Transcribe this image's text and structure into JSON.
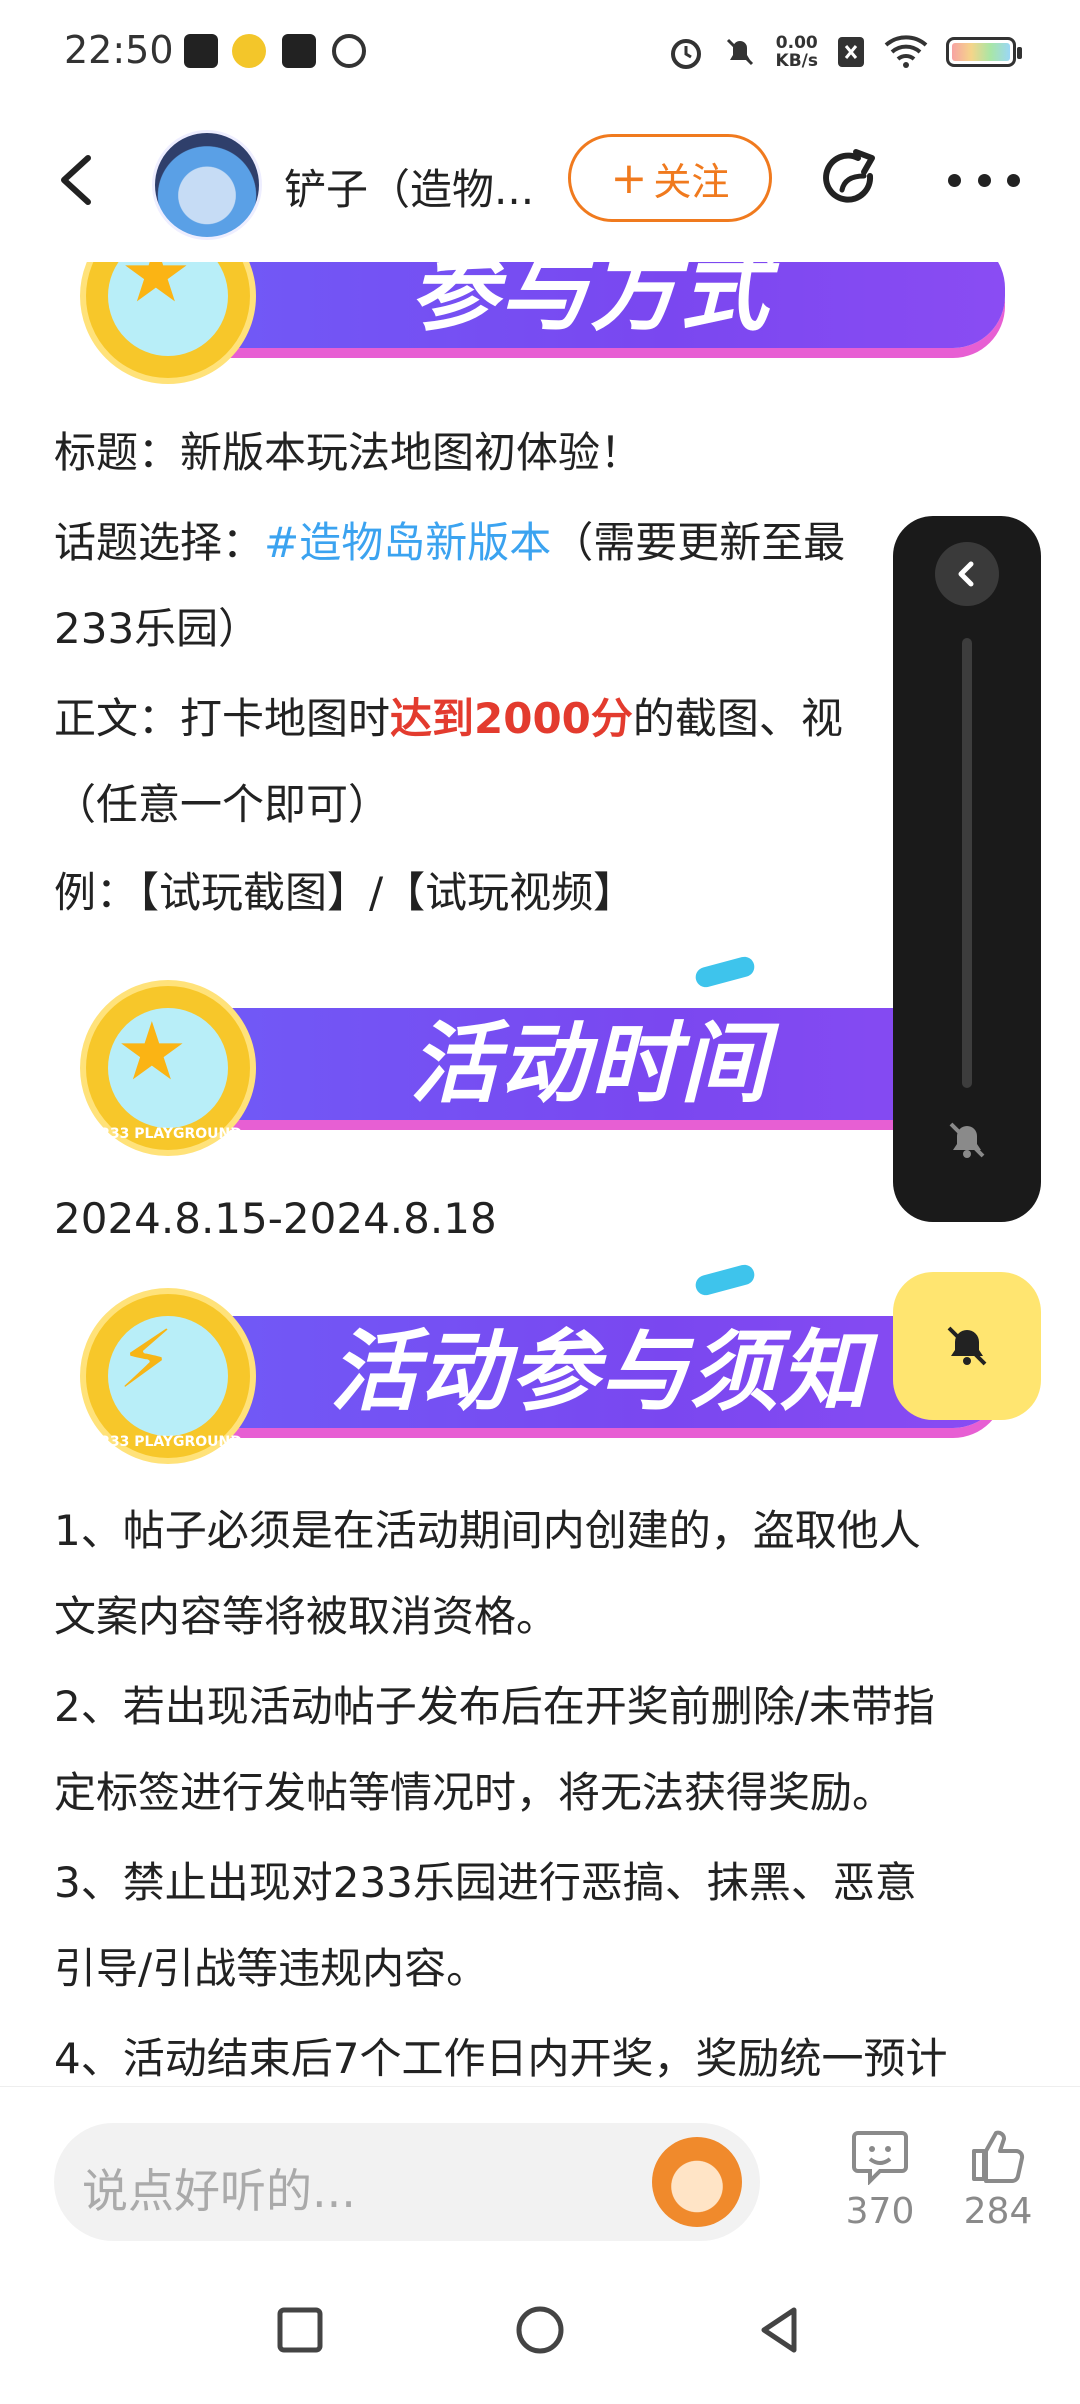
{
  "status_bar": {
    "time": "22:50",
    "net_speed": "0.00",
    "net_unit": "KB/s",
    "icons": [
      "tiktok-icon",
      "app-icon",
      "message-icon",
      "link-icon",
      "alarm-icon",
      "mute-icon",
      "sim-icon",
      "wifi-icon",
      "battery-icon"
    ]
  },
  "header": {
    "author_name": "铲子（造物...",
    "follow_label": "关注",
    "follow_plus": "+"
  },
  "banners": {
    "join_title": "参与方式",
    "time_title": "活动时间",
    "rules_title": "活动参与须知",
    "coin_label": "233 PLAYGROUND"
  },
  "post": {
    "title_line": "标题：新版本玩法地图初体验！",
    "topic_prefix": "话题选择：",
    "topic_tag": "#造物岛新版本",
    "topic_suffix": "（需要更新至最",
    "topic_line2": "233乐园）",
    "body_prefix": "正文：打卡地图时",
    "body_highlight": "达到2000分",
    "body_suffix": "的截图、视",
    "body_line2": "（任意一个即可）",
    "example_line": "例：【试玩截图】/【试玩视频】",
    "date_range": "2024.8.15-2024.8.18",
    "rule1_a": "1、帖子必须是在活动期间内创建的，盗取他人",
    "rule1_b": "文案内容等将被取消资格。",
    "rule2_a": "2、若出现活动帖子发布后在开奖前删除/未带指",
    "rule2_b": "定标签进行发帖等情况时，将无法获得奖励。",
    "rule3_a": "3、禁止出现对233乐园进行恶搞、抹黑、恶意",
    "rule3_b": "引导/引战等违规内容。",
    "rule4_a": "4、活动结束后7个工作日内开奖，奖励统一预计"
  },
  "bottom_bar": {
    "comment_placeholder": "说点好听的...",
    "comment_count": "370",
    "like_count": "284"
  },
  "colors": {
    "accent_orange": "#f07a1e",
    "hashtag_blue": "#3ba3f0",
    "highlight_red": "#e33b2e",
    "banner_purple": "#6f5cf7",
    "mute_yellow": "#ffe570"
  }
}
